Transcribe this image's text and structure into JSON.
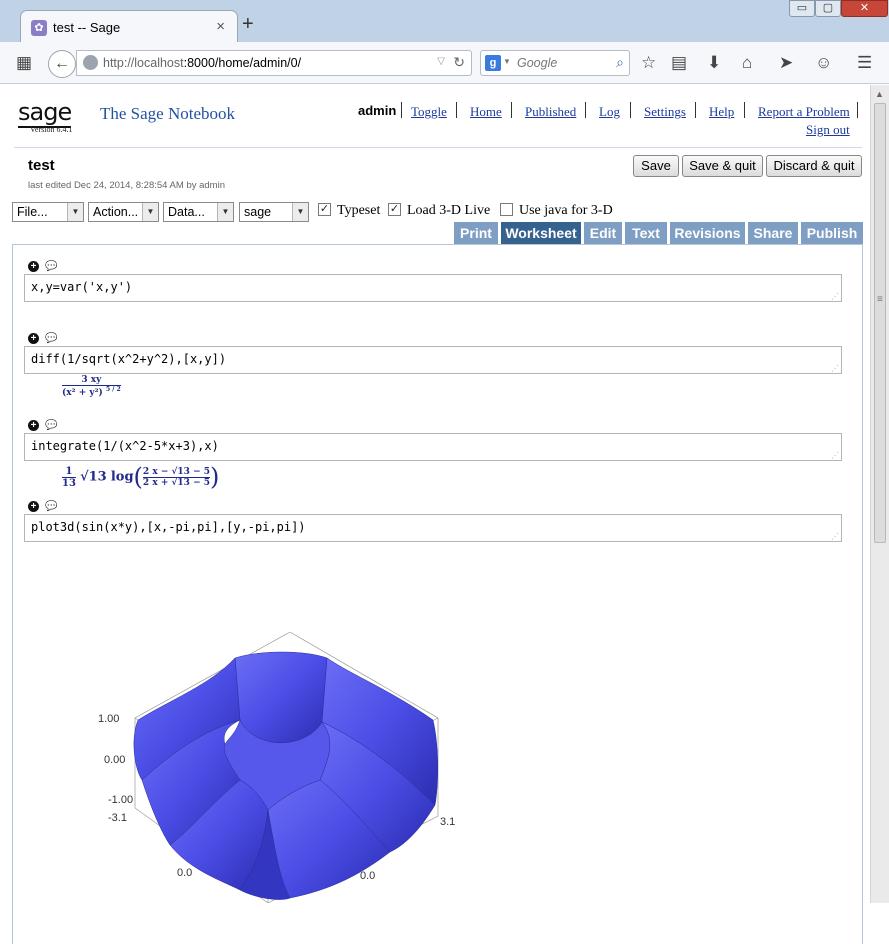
{
  "browser": {
    "tab_title": "test -- Sage",
    "tab_close": "×",
    "new_tab": "+",
    "url_host": "http://localhost",
    "url_path": ":8000/home/admin/0/",
    "search_engine": "g",
    "search_placeholder": "Google",
    "win_min": "▭",
    "win_max": "▢",
    "win_close": "✕"
  },
  "header": {
    "logo": "sage",
    "version": "Version 6.4.1",
    "title": "The Sage Notebook",
    "user": "admin",
    "links": [
      "Toggle",
      "Home",
      "Published",
      "Log",
      "Settings",
      "Help",
      "Report a Problem"
    ],
    "signout": "Sign out"
  },
  "worksheet": {
    "name": "test",
    "last_edited": "last edited Dec 24, 2014, 8:28:54 AM by admin",
    "buttons": {
      "save": "Save",
      "save_quit": "Save & quit",
      "discard_quit": "Discard & quit"
    },
    "selects": {
      "file": "File...",
      "action": "Action...",
      "data": "Data...",
      "system": "sage"
    },
    "checkboxes": {
      "typeset": {
        "label": "Typeset",
        "checked": true
      },
      "load3d": {
        "label": "Load 3-D Live",
        "checked": true
      },
      "java3d": {
        "label": "Use java for 3-D",
        "checked": false
      }
    },
    "tabs": [
      "Print",
      "Worksheet",
      "Edit",
      "Text",
      "Revisions",
      "Share",
      "Publish"
    ],
    "active_tab": "Worksheet"
  },
  "cells": [
    {
      "input": "x,y=var('x,y')"
    },
    {
      "input": "diff(1/sqrt(x^2+y^2),[x,y])",
      "output": {
        "num": "3 xy",
        "den_base": "(x² + y²)",
        "den_exp": "5 / 2"
      }
    },
    {
      "input": "integrate(1/(x^2-5*x+3),x)",
      "output": {
        "coef_num": "1",
        "coef_den": "13",
        "root": "√13",
        "fn": "log",
        "frac_num": "2 x − √13 − 5",
        "frac_den": "2 x + √13 − 5"
      }
    },
    {
      "input": "plot3d(sin(x*y),[x,-pi,pi],[y,-pi,pi])"
    }
  ],
  "plot": {
    "z_ticks": [
      "1.00",
      "0.00",
      "-1.00"
    ],
    "x_left_tick": "-3.1",
    "x_right_tick": "3.1",
    "bottom_ticks": [
      "0.0",
      "0.0"
    ],
    "surface_color": "#4b4ee6"
  }
}
